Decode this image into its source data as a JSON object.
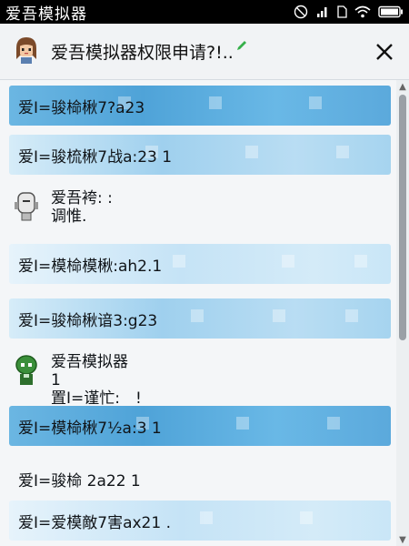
{
  "status_bar": {
    "app_name": "爱吾模拟器",
    "icons": [
      "do-not-disturb-icon",
      "signal-icon",
      "sim-icon",
      "wifi-icon",
      "battery-icon"
    ]
  },
  "header": {
    "title": "爱吾模拟器权限申请?!..",
    "avatar_icon": "girl-avatar-icon",
    "edit_icon": "pencil-icon",
    "close_icon": "close-icon"
  },
  "items": [
    {
      "text": "爱Ⅰ=骏椧楸7?a23"
    },
    {
      "text": "爱Ⅰ=骏梳楸7战a:23 1"
    },
    {
      "text": "爱Ⅰ=模椧模楸:ah2.1"
    },
    {
      "text": "爱Ⅰ=骏椧楸谙3:g23"
    },
    {
      "text": "爱Ⅰ=模椧楸7½a:3 1"
    },
    {
      "text": "爱Ⅰ=骏椧 2a22 1"
    },
    {
      "text": "爱Ⅰ=爱模敵7害ax21 ."
    }
  ],
  "messages": [
    {
      "icon": "robot-icon",
      "lines": [
        "爱吾袴: :",
        "调惟."
      ]
    },
    {
      "icon": "green-alien-icon",
      "title": "爱吾模拟器",
      "lines": [
        "1",
        "置Ⅰ=谨忙:　!"
      ]
    }
  ],
  "colors": {
    "accent_blue": "#4fa3d8",
    "light_blue": "#c5e3f6",
    "edit_green": "#36b04a"
  }
}
